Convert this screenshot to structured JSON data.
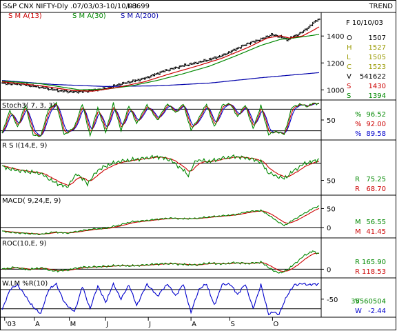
{
  "header": {
    "title": "S&P CNX NIFTY-Dly .07/03/03-10/10/03",
    "code": "I-8699",
    "mode": "TREND"
  },
  "colors": {
    "price": "#000000",
    "sma13": "#cc0000",
    "sma30": "#008800",
    "sma200": "#0000aa",
    "green": "#008800",
    "red": "#cc0000",
    "blue": "#0000cc",
    "olive": "#999900"
  },
  "chart_data": [
    {
      "type": "line",
      "panel": "price",
      "legend": [
        "S M A(13)",
        "S M A(30)",
        "S M A(200)"
      ],
      "ylim": [
        940,
        1560
      ],
      "yticks": [
        1000,
        1200,
        1400
      ],
      "info": {
        "date": "F 10/10/03",
        "rows": [
          {
            "k": "O",
            "v": "1507",
            "color": "#000000"
          },
          {
            "k": "H",
            "v": "1527",
            "color": "#999900"
          },
          {
            "k": "L",
            "v": "1505",
            "color": "#999900"
          },
          {
            "k": "C",
            "v": "1523",
            "color": "#999900"
          },
          {
            "k": "V",
            "v": "541622",
            "color": "#000000"
          },
          {
            "k": "S",
            "v": "1430",
            "color": "#cc0000"
          },
          {
            "k": "S",
            "v": "1394",
            "color": "#008800"
          }
        ]
      },
      "anchors": {
        "close": [
          [
            0,
            1048
          ],
          [
            15,
            1042
          ],
          [
            30,
            1018
          ],
          [
            45,
            992
          ],
          [
            55,
            985
          ],
          [
            65,
            990
          ],
          [
            80,
            1010
          ],
          [
            90,
            1040
          ],
          [
            100,
            1062
          ],
          [
            110,
            1085
          ],
          [
            125,
            1140
          ],
          [
            140,
            1180
          ],
          [
            150,
            1200
          ],
          [
            160,
            1225
          ],
          [
            170,
            1255
          ],
          [
            180,
            1300
          ],
          [
            190,
            1345
          ],
          [
            200,
            1375
          ],
          [
            208,
            1410
          ],
          [
            215,
            1395
          ],
          [
            220,
            1372
          ],
          [
            225,
            1395
          ],
          [
            232,
            1430
          ],
          [
            238,
            1475
          ],
          [
            243,
            1520
          ],
          [
            245,
            1523
          ]
        ],
        "sma13": [
          [
            0,
            1060
          ],
          [
            30,
            1030
          ],
          [
            55,
            995
          ],
          [
            70,
            990
          ],
          [
            90,
            1020
          ],
          [
            110,
            1060
          ],
          [
            130,
            1120
          ],
          [
            150,
            1175
          ],
          [
            170,
            1235
          ],
          [
            190,
            1315
          ],
          [
            205,
            1385
          ],
          [
            215,
            1402
          ],
          [
            222,
            1385
          ],
          [
            232,
            1400
          ],
          [
            240,
            1440
          ],
          [
            245,
            1468
          ]
        ],
        "sma30": [
          [
            0,
            1065
          ],
          [
            30,
            1045
          ],
          [
            60,
            1000
          ],
          [
            80,
            1005
          ],
          [
            100,
            1030
          ],
          [
            120,
            1070
          ],
          [
            140,
            1120
          ],
          [
            160,
            1175
          ],
          [
            180,
            1250
          ],
          [
            200,
            1330
          ],
          [
            215,
            1375
          ],
          [
            225,
            1385
          ],
          [
            235,
            1398
          ],
          [
            245,
            1412
          ]
        ],
        "sma200": [
          [
            0,
            1070
          ],
          [
            40,
            1040
          ],
          [
            80,
            1025
          ],
          [
            120,
            1030
          ],
          [
            160,
            1050
          ],
          [
            200,
            1090
          ],
          [
            245,
            1128
          ]
        ]
      }
    },
    {
      "type": "line",
      "panel": "stoch",
      "label": "Stoch3( 7, 3, 3)",
      "ylim": [
        0,
        100
      ],
      "hlines": [
        20,
        80
      ],
      "yticks": [
        50
      ],
      "readouts": [
        {
          "k": "%",
          "v": "96.52",
          "color": "#008800"
        },
        {
          "k": "%",
          "v": "92.00",
          "color": "#cc0000"
        },
        {
          "k": "%",
          "v": "89.58",
          "color": "#0000cc"
        }
      ],
      "anchors": {
        "k": [
          [
            0,
            12
          ],
          [
            6,
            78
          ],
          [
            12,
            30
          ],
          [
            18,
            92
          ],
          [
            24,
            8
          ],
          [
            30,
            5
          ],
          [
            36,
            82
          ],
          [
            42,
            96
          ],
          [
            48,
            8
          ],
          [
            56,
            30
          ],
          [
            62,
            95
          ],
          [
            68,
            6
          ],
          [
            74,
            85
          ],
          [
            80,
            15
          ],
          [
            86,
            96
          ],
          [
            92,
            20
          ],
          [
            98,
            90
          ],
          [
            104,
            40
          ],
          [
            112,
            92
          ],
          [
            120,
            50
          ],
          [
            128,
            96
          ],
          [
            134,
            70
          ],
          [
            140,
            95
          ],
          [
            146,
            22
          ],
          [
            152,
            55
          ],
          [
            158,
            95
          ],
          [
            164,
            30
          ],
          [
            170,
            90
          ],
          [
            176,
            96
          ],
          [
            182,
            60
          ],
          [
            188,
            92
          ],
          [
            194,
            25
          ],
          [
            200,
            90
          ],
          [
            206,
            10
          ],
          [
            212,
            18
          ],
          [
            218,
            10
          ],
          [
            224,
            85
          ],
          [
            230,
            94
          ],
          [
            236,
            88
          ],
          [
            240,
            96
          ],
          [
            245,
            96
          ]
        ]
      }
    },
    {
      "type": "line",
      "panel": "rsi",
      "label": "R S I(14,E, 9)",
      "ylim": [
        35,
        95
      ],
      "hlines": [
        70
      ],
      "yticks": [
        50
      ],
      "readouts": [
        {
          "k": "R",
          "v": "75.25",
          "color": "#008800"
        },
        {
          "k": "R",
          "v": "68.70",
          "color": "#cc0000"
        }
      ],
      "anchors": {
        "rsi": [
          [
            0,
            66
          ],
          [
            10,
            62
          ],
          [
            20,
            60
          ],
          [
            30,
            58
          ],
          [
            40,
            48
          ],
          [
            50,
            42
          ],
          [
            58,
            58
          ],
          [
            66,
            46
          ],
          [
            74,
            62
          ],
          [
            82,
            68
          ],
          [
            90,
            72
          ],
          [
            100,
            74
          ],
          [
            110,
            76
          ],
          [
            120,
            78
          ],
          [
            130,
            74
          ],
          [
            140,
            62
          ],
          [
            144,
            56
          ],
          [
            150,
            74
          ],
          [
            160,
            72
          ],
          [
            170,
            76
          ],
          [
            180,
            78
          ],
          [
            190,
            76
          ],
          [
            200,
            72
          ],
          [
            205,
            60
          ],
          [
            210,
            56
          ],
          [
            218,
            52
          ],
          [
            226,
            62
          ],
          [
            234,
            70
          ],
          [
            240,
            72
          ],
          [
            245,
            75
          ]
        ]
      }
    },
    {
      "type": "line",
      "panel": "macd",
      "label": "MACD( 9,24,E, 9)",
      "ylim": [
        -22,
        80
      ],
      "hlines": [
        0
      ],
      "yticks": [
        50,
        0
      ],
      "readouts": [
        {
          "k": "M",
          "v": "56.55",
          "color": "#008800"
        },
        {
          "k": "M",
          "v": "41.45",
          "color": "#cc0000"
        }
      ],
      "anchors": {
        "macd": [
          [
            0,
            -10
          ],
          [
            10,
            -14
          ],
          [
            20,
            -16
          ],
          [
            30,
            -18
          ],
          [
            40,
            -12
          ],
          [
            50,
            -15
          ],
          [
            60,
            -9
          ],
          [
            70,
            -4
          ],
          [
            80,
            -2
          ],
          [
            90,
            6
          ],
          [
            100,
            15
          ],
          [
            110,
            18
          ],
          [
            120,
            22
          ],
          [
            130,
            25
          ],
          [
            140,
            23
          ],
          [
            150,
            24
          ],
          [
            160,
            28
          ],
          [
            170,
            31
          ],
          [
            180,
            34
          ],
          [
            190,
            42
          ],
          [
            200,
            45
          ],
          [
            206,
            33
          ],
          [
            212,
            18
          ],
          [
            218,
            5
          ],
          [
            226,
            22
          ],
          [
            234,
            38
          ],
          [
            240,
            50
          ],
          [
            245,
            57
          ]
        ]
      }
    },
    {
      "type": "line",
      "panel": "roc",
      "label": "ROC(10,E, 9)",
      "ylim": [
        -70,
        310
      ],
      "hlines": [
        0
      ],
      "yticks": [
        0
      ],
      "readouts": [
        {
          "k": "R",
          "v": "165.90",
          "color": "#008800"
        },
        {
          "k": "R",
          "v": "118.53",
          "color": "#cc0000"
        }
      ],
      "anchors": {
        "roc": [
          [
            0,
            0
          ],
          [
            10,
            20
          ],
          [
            20,
            -5
          ],
          [
            30,
            15
          ],
          [
            40,
            -20
          ],
          [
            50,
            -10
          ],
          [
            60,
            20
          ],
          [
            70,
            25
          ],
          [
            80,
            30
          ],
          [
            90,
            40
          ],
          [
            100,
            35
          ],
          [
            110,
            45
          ],
          [
            120,
            55
          ],
          [
            130,
            60
          ],
          [
            140,
            50
          ],
          [
            150,
            45
          ],
          [
            160,
            65
          ],
          [
            170,
            55
          ],
          [
            180,
            70
          ],
          [
            190,
            60
          ],
          [
            200,
            75
          ],
          [
            205,
            30
          ],
          [
            210,
            -20
          ],
          [
            216,
            -40
          ],
          [
            222,
            10
          ],
          [
            228,
            80
          ],
          [
            234,
            150
          ],
          [
            240,
            190
          ],
          [
            245,
            166
          ]
        ]
      }
    },
    {
      "type": "line",
      "panel": "wlm",
      "label": "W.LM %R(10)",
      "ylim": [
        -100,
        10
      ],
      "hlines": [
        -20,
        -80
      ],
      "yticks": [
        -50
      ],
      "readouts": [
        {
          "k": "V",
          "v": "35560504",
          "color": "#008800"
        },
        {
          "k": "W",
          "v": "-2.44",
          "color": "#0000cc"
        }
      ],
      "anchors": {
        "wlm": [
          [
            0,
            -85
          ],
          [
            6,
            -20
          ],
          [
            12,
            -5
          ],
          [
            18,
            -40
          ],
          [
            24,
            -75
          ],
          [
            30,
            -95
          ],
          [
            36,
            -20
          ],
          [
            42,
            -2
          ],
          [
            48,
            -60
          ],
          [
            56,
            -90
          ],
          [
            62,
            -10
          ],
          [
            68,
            -80
          ],
          [
            74,
            -8
          ],
          [
            80,
            -60
          ],
          [
            86,
            -2
          ],
          [
            92,
            -50
          ],
          [
            98,
            -5
          ],
          [
            104,
            -70
          ],
          [
            112,
            -3
          ],
          [
            120,
            -40
          ],
          [
            128,
            -2
          ],
          [
            134,
            -40
          ],
          [
            140,
            -3
          ],
          [
            146,
            -92
          ],
          [
            152,
            -20
          ],
          [
            158,
            -2
          ],
          [
            164,
            -70
          ],
          [
            170,
            -5
          ],
          [
            176,
            -2
          ],
          [
            182,
            -35
          ],
          [
            188,
            -3
          ],
          [
            194,
            -80
          ],
          [
            200,
            -5
          ],
          [
            206,
            -98
          ],
          [
            210,
            -90
          ],
          [
            214,
            -99
          ],
          [
            220,
            -40
          ],
          [
            226,
            -5
          ],
          [
            232,
            -2
          ],
          [
            238,
            -5
          ],
          [
            245,
            -2
          ]
        ]
      }
    },
    {
      "type": "table",
      "panel": "x-axis",
      "months": [
        {
          "label": "'03",
          "i": 2
        },
        {
          "label": "A",
          "i": 25
        },
        {
          "label": "M",
          "i": 52
        },
        {
          "label": "J",
          "i": 80
        },
        {
          "label": "J",
          "i": 113
        },
        {
          "label": "A",
          "i": 146
        },
        {
          "label": "S",
          "i": 176
        },
        {
          "label": "O",
          "i": 209
        }
      ]
    }
  ]
}
